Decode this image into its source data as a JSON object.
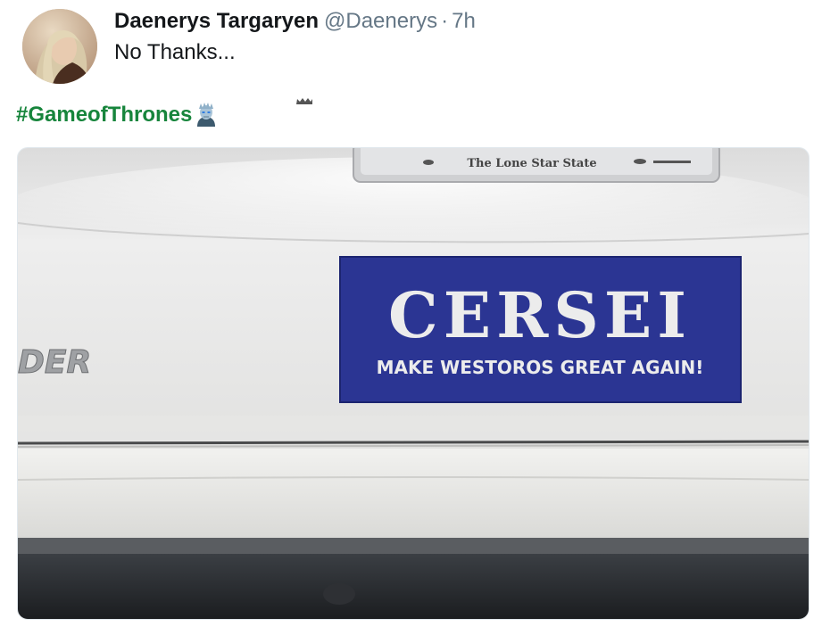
{
  "tweet": {
    "display_name": "Daenerys Targaryen",
    "handle": "@Daenerys",
    "separator": "·",
    "timestamp": "7h",
    "text": "No Thanks...",
    "hashtag": "#GameofThrones",
    "hashtag_color": "#17853c",
    "hashflag_icon": "night-king-emoji-icon"
  },
  "photo": {
    "plate_text": "The Lone Star State",
    "sticker_title": "CERSEI",
    "sticker_subtitle": "MAKE WESTOROS GREAT AGAIN!",
    "badge_text": "DER",
    "sticker_color": "#2b3593"
  }
}
